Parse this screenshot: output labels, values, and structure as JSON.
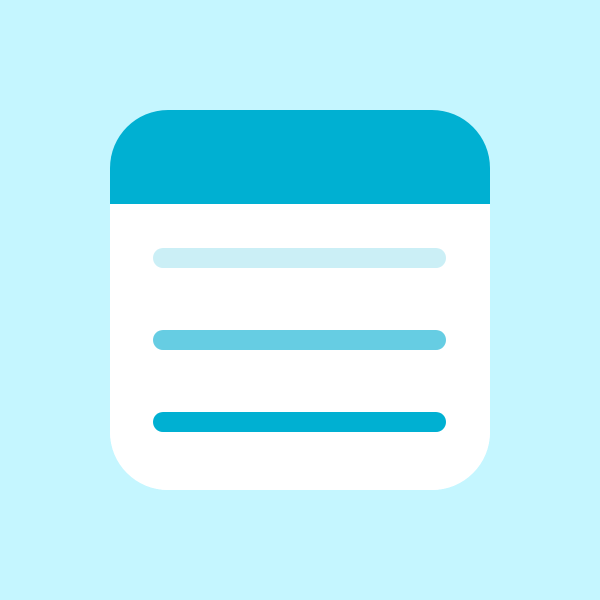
{
  "icon": {
    "name": "notes-list-icon",
    "colors": {
      "background": "#C5F6FF",
      "card": "#FFFFFF",
      "header": "#00B0D2",
      "line_light": "#CBEFF6",
      "line_medium": "#66CDE3",
      "line_dark": "#00B0D2"
    }
  }
}
